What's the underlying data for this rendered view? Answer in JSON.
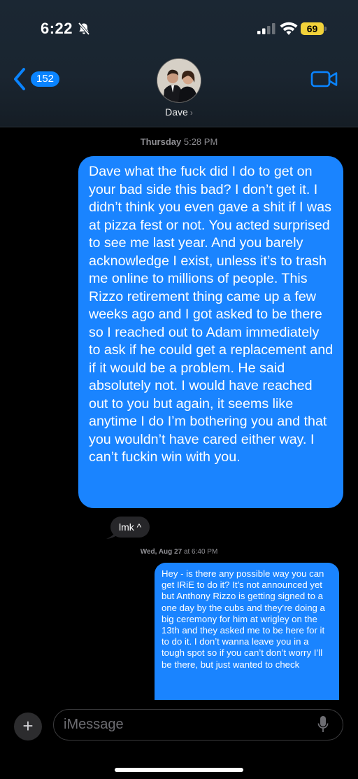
{
  "status_bar": {
    "time": "6:22",
    "battery": "69"
  },
  "header": {
    "back_count": "152",
    "contact_name": "Dave"
  },
  "conversation": {
    "timestamp_1": {
      "day": "Thursday",
      "time": "5:28 PM"
    },
    "message_1": "Dave what the fuck did I do to get on your bad side this bad? I don’t get it. I didn’t think you even gave a shit if I was at pizza fest or not. You acted surprised to see me last year. And you barely acknowledge I exist, unless it’s to trash me online to millions of people. This Rizzo retirement thing came up a few weeks ago and I got asked to be there so I reached out to Adam immediately to ask if he could get a replacement and if it would be a problem. He said absolutely not. I would have reached out to you but again, it seems like anytime I do I’m bothering you and that you wouldn’t have cared either way. I can’t fuckin win with you.",
    "reply_1": "lmk ^",
    "timestamp_2": {
      "day": "Wed, Aug 27",
      "time": "at 6:40 PM"
    },
    "message_2": "Hey - is there any possible way you can get IRiE to do it? It’s not announced yet but Anthony Rizzo is getting signed to a one day by the cubs and they’re doing a big ceremony for him at wrigley on the 13th and they asked me to be here for it to do it. I don’t wanna leave you in a tough spot so if you can’t don’t worry I’ll be there, but just wanted to check"
  },
  "input": {
    "placeholder": "iMessage"
  },
  "colors": {
    "accent": "#0a84ff",
    "outgoing_bubble": "#1a84ff",
    "incoming_bubble": "#262629",
    "battery": "#f2d23a"
  },
  "icons": [
    "bell-slash-icon",
    "signal-icon",
    "wifi-icon",
    "battery-icon",
    "chevron-left-icon",
    "video-camera-icon",
    "plus-icon",
    "microphone-icon"
  ]
}
